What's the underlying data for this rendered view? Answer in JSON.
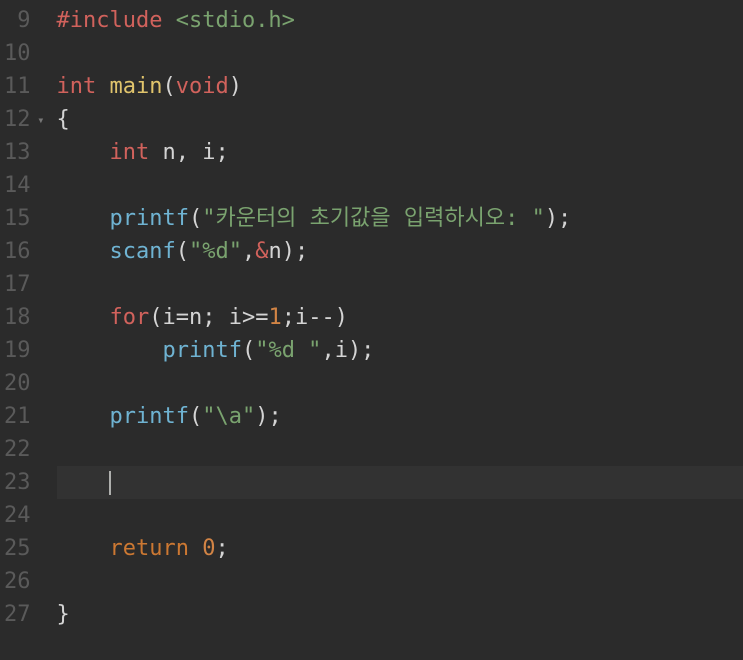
{
  "editor": {
    "first_line_number": 9,
    "current_line_index": 14,
    "fold_line_index": 3,
    "lines": [
      [
        {
          "cls": "tok-pp",
          "t": "#include"
        },
        {
          "cls": "tok-op",
          "t": " "
        },
        {
          "cls": "tok-inc",
          "t": "<stdio.h>"
        }
      ],
      [],
      [
        {
          "cls": "tok-type",
          "t": "int"
        },
        {
          "cls": "tok-op",
          "t": " "
        },
        {
          "cls": "tok-fn2",
          "t": "main"
        },
        {
          "cls": "tok-punc",
          "t": "("
        },
        {
          "cls": "tok-type",
          "t": "void"
        },
        {
          "cls": "tok-punc",
          "t": ")"
        }
      ],
      [
        {
          "cls": "tok-punc",
          "t": "{"
        }
      ],
      [
        {
          "cls": "tok-op",
          "t": "    "
        },
        {
          "cls": "tok-type",
          "t": "int"
        },
        {
          "cls": "tok-op",
          "t": " "
        },
        {
          "cls": "tok-id",
          "t": "n"
        },
        {
          "cls": "tok-punc",
          "t": ", "
        },
        {
          "cls": "tok-id",
          "t": "i"
        },
        {
          "cls": "tok-punc",
          "t": ";"
        }
      ],
      [
        {
          "cls": "tok-op",
          "t": "    "
        }
      ],
      [
        {
          "cls": "tok-op",
          "t": "    "
        },
        {
          "cls": "tok-fn",
          "t": "printf"
        },
        {
          "cls": "tok-punc",
          "t": "("
        },
        {
          "cls": "tok-str",
          "t": "\"카운터의 초기값을 입력하시오: \""
        },
        {
          "cls": "tok-punc",
          "t": ");"
        }
      ],
      [
        {
          "cls": "tok-op",
          "t": "    "
        },
        {
          "cls": "tok-fn",
          "t": "scanf"
        },
        {
          "cls": "tok-punc",
          "t": "("
        },
        {
          "cls": "tok-str",
          "t": "\"%d\""
        },
        {
          "cls": "tok-punc",
          "t": ","
        },
        {
          "cls": "tok-amp",
          "t": "&"
        },
        {
          "cls": "tok-id",
          "t": "n"
        },
        {
          "cls": "tok-punc",
          "t": ");"
        }
      ],
      [
        {
          "cls": "tok-op",
          "t": "    "
        }
      ],
      [
        {
          "cls": "tok-op",
          "t": "    "
        },
        {
          "cls": "tok-kw",
          "t": "for"
        },
        {
          "cls": "tok-punc",
          "t": "("
        },
        {
          "cls": "tok-id",
          "t": "i"
        },
        {
          "cls": "tok-op",
          "t": "="
        },
        {
          "cls": "tok-id",
          "t": "n"
        },
        {
          "cls": "tok-punc",
          "t": "; "
        },
        {
          "cls": "tok-id",
          "t": "i"
        },
        {
          "cls": "tok-op",
          "t": ">="
        },
        {
          "cls": "tok-num",
          "t": "1"
        },
        {
          "cls": "tok-punc",
          "t": ";"
        },
        {
          "cls": "tok-id",
          "t": "i"
        },
        {
          "cls": "tok-op",
          "t": "--"
        },
        {
          "cls": "tok-punc",
          "t": ")"
        }
      ],
      [
        {
          "cls": "tok-op",
          "t": "        "
        },
        {
          "cls": "tok-fn",
          "t": "printf"
        },
        {
          "cls": "tok-punc",
          "t": "("
        },
        {
          "cls": "tok-str",
          "t": "\"%d \""
        },
        {
          "cls": "tok-punc",
          "t": ","
        },
        {
          "cls": "tok-id",
          "t": "i"
        },
        {
          "cls": "tok-punc",
          "t": ");"
        }
      ],
      [
        {
          "cls": "tok-op",
          "t": "    "
        }
      ],
      [
        {
          "cls": "tok-op",
          "t": "    "
        },
        {
          "cls": "tok-fn",
          "t": "printf"
        },
        {
          "cls": "tok-punc",
          "t": "("
        },
        {
          "cls": "tok-str",
          "t": "\"\\a\""
        },
        {
          "cls": "tok-punc",
          "t": ");"
        }
      ],
      [
        {
          "cls": "tok-op",
          "t": "    "
        }
      ],
      [
        {
          "cls": "tok-op",
          "t": "    "
        }
      ],
      [
        {
          "cls": "tok-op",
          "t": "    "
        }
      ],
      [
        {
          "cls": "tok-op",
          "t": "    "
        },
        {
          "cls": "tok-kw2",
          "t": "return"
        },
        {
          "cls": "tok-op",
          "t": " "
        },
        {
          "cls": "tok-num",
          "t": "0"
        },
        {
          "cls": "tok-punc",
          "t": ";"
        }
      ],
      [
        {
          "cls": "tok-op",
          "t": "    "
        }
      ],
      [
        {
          "cls": "tok-punc",
          "t": "}"
        }
      ]
    ]
  }
}
